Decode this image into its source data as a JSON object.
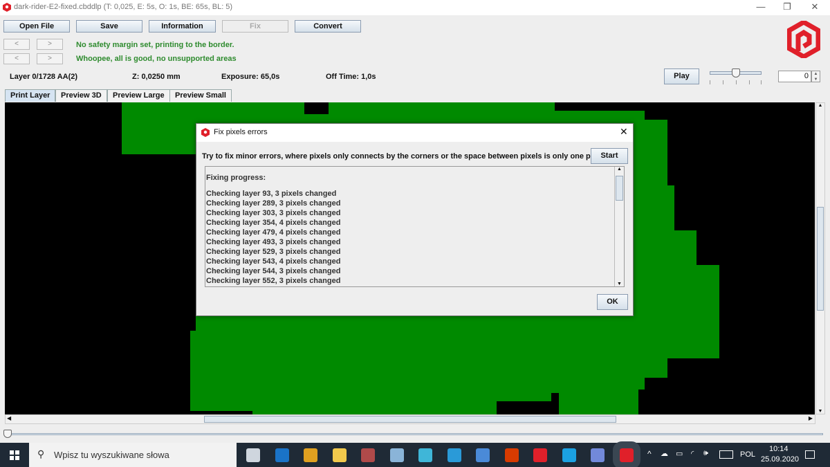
{
  "window": {
    "title": "dark-rider-E2-fixed.cbddlp (T: 0,025, E: 5s, O: 1s, BE: 65s, BL: 5)",
    "minimize": "—",
    "maximize": "❐",
    "close": "✕"
  },
  "toolbar": {
    "open_file": "Open File",
    "save": "Save",
    "information": "Information",
    "fix": "Fix",
    "convert": "Convert"
  },
  "nav": {
    "prev": "<",
    "next": ">"
  },
  "messages": {
    "margin": "No safety margin set, printing to the border.",
    "supports": "Whoopee, all is good, no unsupported areas"
  },
  "status": {
    "layer": "Layer 0/1728 AA(2)",
    "z": "Z: 0,0250 mm",
    "exposure": "Exposure: 65,0s",
    "off_time": "Off Time: 1,0s"
  },
  "playback": {
    "play": "Play",
    "spinner_value": "0",
    "speed_slider_level": 0.5
  },
  "tabs": [
    {
      "label": "Print Layer",
      "active": true
    },
    {
      "label": "Preview 3D"
    },
    {
      "label": "Preview Large"
    },
    {
      "label": "Preview Small"
    }
  ],
  "colors": {
    "layer_fill": "#008a00",
    "brand_red": "#e0202a",
    "message_green": "#2e8b2e"
  },
  "dialog": {
    "title": "Fix pixels errors",
    "description": "Try to fix minor errors, where pixels only connects by the corners or the space between pixels is only one pixel.",
    "start": "Start",
    "ok": "OK",
    "close": "✕",
    "progress_header": "Fixing progress:",
    "log": [
      "Checking layer 93, 3 pixels changed",
      "Checking layer 289, 3 pixels changed",
      "Checking layer 303, 3 pixels changed",
      "Checking layer 354, 4 pixels changed",
      "Checking layer 479, 4 pixels changed",
      "Checking layer 493, 3 pixels changed",
      "Checking layer 529, 3 pixels changed",
      "Checking layer 543, 4 pixels changed",
      "Checking layer 544, 3 pixels changed",
      "Checking layer 552, 3 pixels changed"
    ]
  },
  "taskbar": {
    "search_placeholder": "Wpisz tu wyszukiwane słowa",
    "apps": [
      "task-view",
      "outlook",
      "chrome",
      "file-explorer",
      "gem-app",
      "paint-app",
      "wave-app",
      "n-app",
      "window-app",
      "office",
      "chitubox",
      "c-app",
      "discord",
      "chitubox-active"
    ],
    "language": "POL",
    "time": "10:14",
    "date": "25.09.2020"
  }
}
